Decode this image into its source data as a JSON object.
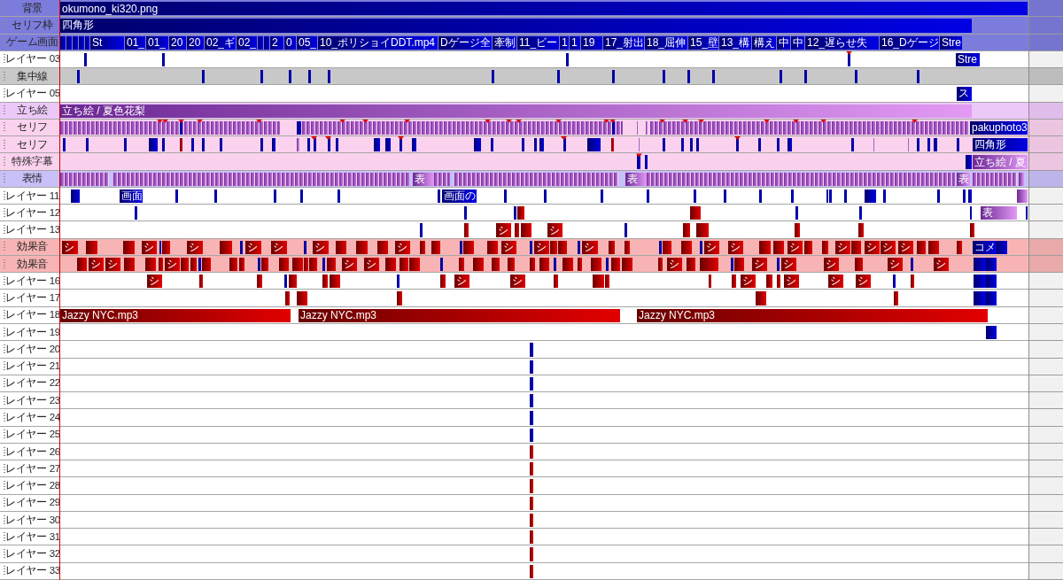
{
  "layers": [
    {
      "label": "背景",
      "color": "#7c7cdc",
      "clips": [
        {
          "kind": "visual",
          "label": "okumono_ki320.png"
        }
      ]
    },
    {
      "label": "セリフ枠",
      "color": "#7c7cdc",
      "clips": [
        {
          "kind": "visual",
          "label": "四角形"
        }
      ]
    },
    {
      "label": "ゲーム画面",
      "color": "#7c7cdc",
      "clips": [
        {
          "kind": "visual"
        },
        {
          "kind": "visual"
        },
        {
          "kind": "visual"
        },
        {
          "kind": "visual"
        },
        {
          "kind": "visual"
        },
        {
          "kind": "visual",
          "label": "St"
        },
        {
          "kind": "visual",
          "label": "01_"
        },
        {
          "kind": "visual",
          "label": "01_"
        },
        {
          "kind": "visual",
          "label": "20"
        },
        {
          "kind": "visual",
          "label": "20"
        },
        {
          "kind": "visual",
          "label": "02_ギ"
        },
        {
          "kind": "visual",
          "label": "02_"
        },
        {
          "kind": "visual"
        },
        {
          "kind": "visual"
        },
        {
          "kind": "visual",
          "label": "2"
        },
        {
          "kind": "visual",
          "label": "0"
        },
        {
          "kind": "visual",
          "label": "05_"
        },
        {
          "kind": "visual",
          "label": "10_ポリショイDDT.mp4"
        },
        {
          "kind": "visual",
          "label": "Dゲージ全"
        },
        {
          "kind": "visual",
          "label": "牽制"
        },
        {
          "kind": "visual",
          "label": "11_ビー"
        },
        {
          "kind": "visual",
          "label": "1"
        },
        {
          "kind": "visual",
          "label": "1"
        },
        {
          "kind": "visual",
          "label": "19"
        },
        {
          "kind": "visual",
          "label": "17_射出"
        },
        {
          "kind": "visual",
          "label": "18_屈伸"
        },
        {
          "kind": "visual",
          "label": "15_壁"
        },
        {
          "kind": "visual",
          "label": "13_構"
        },
        {
          "kind": "visual",
          "label": "構え"
        },
        {
          "kind": "visual",
          "label": "中"
        },
        {
          "kind": "visual",
          "label": "中"
        },
        {
          "kind": "visual",
          "label": "12_遅らせ失"
        },
        {
          "kind": "visual",
          "label": "16_Dゲージ"
        },
        {
          "kind": "visual",
          "label": "Stre"
        }
      ]
    },
    {
      "label": "レイヤー 03",
      "color": "#ffffff",
      "clips": [
        {
          "kind": "visual"
        },
        {
          "kind": "visual"
        },
        {
          "kind": "visual"
        },
        {
          "kind": "visual"
        },
        {
          "kind": "visual",
          "label": "Stre"
        }
      ]
    },
    {
      "label": "集中線",
      "color": "#c8c8c8",
      "clips": [
        {
          "kind": "visual"
        },
        {
          "kind": "visual"
        },
        {
          "kind": "visual"
        },
        {
          "kind": "visual"
        },
        {
          "kind": "visual"
        },
        {
          "kind": "visual"
        },
        {
          "kind": "visual"
        },
        {
          "kind": "visual"
        },
        {
          "kind": "visual"
        },
        {
          "kind": "visual"
        },
        {
          "kind": "visual"
        },
        {
          "kind": "visual"
        },
        {
          "kind": "visual"
        },
        {
          "kind": "visual"
        },
        {
          "kind": "visual"
        },
        {
          "kind": "visual"
        }
      ]
    },
    {
      "label": "レイヤー 05",
      "color": "#ffffff",
      "clips": [
        {
          "kind": "visual",
          "label": "ス"
        }
      ]
    },
    {
      "label": "立ち絵",
      "color": "#ecc8f8",
      "clips": [
        {
          "kind": "character",
          "label": "立ち絵 / 夏色花梨"
        }
      ]
    },
    {
      "label": "セリフ",
      "color": "#fad2ee",
      "clips": [
        {
          "kind": "visual"
        },
        {
          "kind": "visual"
        },
        {
          "kind": "visual"
        },
        {
          "kind": "character"
        },
        {
          "kind": "character"
        },
        {
          "kind": "visual",
          "label": "pakuphoto3"
        }
      ]
    },
    {
      "label": "セリフ",
      "color": "#fad2ee",
      "clips": [
        {
          "kind": "visual"
        },
        {
          "kind": "visual"
        },
        {
          "kind": "visual"
        },
        {
          "kind": "visual"
        },
        {
          "kind": "visual"
        },
        {
          "kind": "audio"
        },
        {
          "kind": "visual"
        },
        {
          "kind": "visual"
        },
        {
          "kind": "visual"
        },
        {
          "kind": "visual"
        },
        {
          "kind": "visual"
        },
        {
          "kind": "character"
        },
        {
          "kind": "visual"
        },
        {
          "kind": "visual"
        },
        {
          "kind": "visual"
        },
        {
          "kind": "visual"
        },
        {
          "kind": "visual"
        },
        {
          "kind": "visual"
        },
        {
          "kind": "visual"
        },
        {
          "kind": "visual"
        },
        {
          "kind": "visual"
        },
        {
          "kind": "visual"
        },
        {
          "kind": "visual"
        },
        {
          "kind": "visual"
        },
        {
          "kind": "visual"
        },
        {
          "kind": "visual"
        },
        {
          "kind": "visual"
        },
        {
          "kind": "audio"
        },
        {
          "kind": "character"
        },
        {
          "kind": "visual"
        },
        {
          "kind": "visual"
        },
        {
          "kind": "visual"
        },
        {
          "kind": "visual"
        },
        {
          "kind": "visual"
        },
        {
          "kind": "visual"
        },
        {
          "kind": "visual"
        },
        {
          "kind": "visual"
        },
        {
          "kind": "visual"
        },
        {
          "kind": "character"
        },
        {
          "kind": "character"
        },
        {
          "kind": "visual"
        },
        {
          "kind": "visual"
        },
        {
          "kind": "visual"
        },
        {
          "kind": "visual"
        },
        {
          "kind": "visual",
          "label": "四角形"
        }
      ]
    },
    {
      "label": "特殊字幕",
      "color": "#fad2ee",
      "clips": [
        {
          "kind": "visual"
        },
        {
          "kind": "visual"
        },
        {
          "kind": "visual"
        },
        {
          "kind": "character",
          "label": "立ち絵 / 夏"
        }
      ]
    },
    {
      "label": "表情",
      "color": "#c8c0f8",
      "clips": [
        {
          "kind": "character",
          "label": "表"
        },
        {
          "kind": "character",
          "label": "表"
        },
        {
          "kind": "character",
          "label": "表"
        },
        {
          "kind": "character"
        }
      ]
    },
    {
      "label": "レイヤー 11",
      "color": "#ffffff",
      "clips": [
        {
          "kind": "visual"
        },
        {
          "kind": "visual",
          "label": "画面"
        },
        {
          "kind": "visual"
        },
        {
          "kind": "visual"
        },
        {
          "kind": "visual"
        },
        {
          "kind": "visual"
        },
        {
          "kind": "visual"
        },
        {
          "kind": "visual"
        },
        {
          "kind": "visual",
          "label": "画面の"
        },
        {
          "kind": "visual"
        },
        {
          "kind": "visual"
        },
        {
          "kind": "visual"
        },
        {
          "kind": "visual"
        },
        {
          "kind": "visual"
        },
        {
          "kind": "visual"
        },
        {
          "kind": "visual"
        },
        {
          "kind": "visual"
        },
        {
          "kind": "visual"
        },
        {
          "kind": "visual"
        },
        {
          "kind": "visual"
        },
        {
          "kind": "visual"
        },
        {
          "kind": "visual"
        },
        {
          "kind": "visual"
        },
        {
          "kind": "visual"
        },
        {
          "kind": "visual"
        },
        {
          "kind": "character"
        }
      ]
    },
    {
      "label": "レイヤー 12",
      "color": "#ffffff",
      "clips": [
        {
          "kind": "visual"
        },
        {
          "kind": "visual"
        },
        {
          "kind": "visual"
        },
        {
          "kind": "audio"
        },
        {
          "kind": "audio"
        },
        {
          "kind": "visual"
        },
        {
          "kind": "visual"
        },
        {
          "kind": "visual"
        },
        {
          "kind": "character",
          "label": "表"
        },
        {
          "kind": "visual"
        }
      ]
    },
    {
      "label": "レイヤー 13",
      "color": "#ffffff",
      "clips": [
        {
          "kind": "visual"
        },
        {
          "kind": "audio"
        },
        {
          "kind": "audio",
          "label": "シ"
        },
        {
          "kind": "audio"
        },
        {
          "kind": "audio"
        },
        {
          "kind": "audio",
          "label": "シ"
        },
        {
          "kind": "visual"
        },
        {
          "kind": "audio"
        },
        {
          "kind": "audio"
        },
        {
          "kind": "audio"
        },
        {
          "kind": "audio"
        },
        {
          "kind": "audio"
        }
      ]
    },
    {
      "label": "効果音",
      "color": "#f8b4b4",
      "clips": [
        {
          "kind": "audio",
          "label": "シ"
        },
        {
          "kind": "audio"
        },
        {
          "kind": "audio"
        },
        {
          "kind": "audio",
          "label": "シ"
        },
        {
          "kind": "visual"
        },
        {
          "kind": "audio"
        },
        {
          "kind": "audio",
          "label": "シ"
        },
        {
          "kind": "audio"
        },
        {
          "kind": "visual"
        },
        {
          "kind": "audio",
          "label": "シ"
        },
        {
          "kind": "audio",
          "label": "シ"
        },
        {
          "kind": "visual"
        },
        {
          "kind": "audio",
          "label": "シ"
        },
        {
          "kind": "audio"
        },
        {
          "kind": "audio"
        },
        {
          "kind": "audio"
        },
        {
          "kind": "audio",
          "label": "シ"
        },
        {
          "kind": "audio"
        },
        {
          "kind": "audio"
        },
        {
          "kind": "visual"
        },
        {
          "kind": "audio"
        },
        {
          "kind": "audio"
        },
        {
          "kind": "audio",
          "label": "シ"
        },
        {
          "kind": "visual"
        },
        {
          "kind": "audio",
          "label": "シ"
        },
        {
          "kind": "audio"
        },
        {
          "kind": "audio"
        },
        {
          "kind": "visual"
        },
        {
          "kind": "audio",
          "label": "シ"
        },
        {
          "kind": "audio"
        },
        {
          "kind": "audio"
        },
        {
          "kind": "visual"
        },
        {
          "kind": "audio"
        },
        {
          "kind": "audio"
        },
        {
          "kind": "visual"
        },
        {
          "kind": "audio",
          "label": "シ"
        },
        {
          "kind": "audio",
          "label": "シ"
        },
        {
          "kind": "audio"
        },
        {
          "kind": "audio"
        },
        {
          "kind": "audio",
          "label": "シ"
        },
        {
          "kind": "audio"
        },
        {
          "kind": "audio"
        },
        {
          "kind": "audio",
          "label": "シ"
        },
        {
          "kind": "audio"
        },
        {
          "kind": "audio",
          "label": "シ"
        },
        {
          "kind": "audio",
          "label": "シ"
        },
        {
          "kind": "audio",
          "label": "シ"
        },
        {
          "kind": "audio"
        },
        {
          "kind": "audio"
        },
        {
          "kind": "audio"
        },
        {
          "kind": "visual",
          "label": "コメ"
        },
        {
          "kind": "visual"
        }
      ]
    },
    {
      "label": "効果音",
      "color": "#f8b4b4",
      "clips": [
        {
          "kind": "audio"
        },
        {
          "kind": "audio",
          "label": "シ"
        },
        {
          "kind": "audio",
          "label": "シ"
        },
        {
          "kind": "audio"
        },
        {
          "kind": "audio"
        },
        {
          "kind": "audio"
        },
        {
          "kind": "audio",
          "label": "シ"
        },
        {
          "kind": "audio"
        },
        {
          "kind": "audio"
        },
        {
          "kind": "visual"
        },
        {
          "kind": "audio"
        },
        {
          "kind": "audio"
        },
        {
          "kind": "audio"
        },
        {
          "kind": "visual"
        },
        {
          "kind": "audio"
        },
        {
          "kind": "audio"
        },
        {
          "kind": "audio"
        },
        {
          "kind": "audio"
        },
        {
          "kind": "audio"
        },
        {
          "kind": "visual"
        },
        {
          "kind": "audio"
        },
        {
          "kind": "audio",
          "label": "シ"
        },
        {
          "kind": "audio",
          "label": "シ"
        },
        {
          "kind": "audio"
        },
        {
          "kind": "audio"
        },
        {
          "kind": "audio"
        },
        {
          "kind": "visual"
        },
        {
          "kind": "audio"
        },
        {
          "kind": "audio"
        },
        {
          "kind": "audio"
        },
        {
          "kind": "audio"
        },
        {
          "kind": "audio"
        },
        {
          "kind": "audio"
        },
        {
          "kind": "visual"
        },
        {
          "kind": "audio"
        },
        {
          "kind": "audio"
        },
        {
          "kind": "audio"
        },
        {
          "kind": "visual"
        },
        {
          "kind": "audio"
        },
        {
          "kind": "audio"
        },
        {
          "kind": "audio"
        },
        {
          "kind": "audio",
          "label": "シ"
        },
        {
          "kind": "audio"
        },
        {
          "kind": "audio"
        },
        {
          "kind": "visual"
        },
        {
          "kind": "audio"
        },
        {
          "kind": "audio",
          "label": "シ"
        },
        {
          "kind": "visual"
        },
        {
          "kind": "audio",
          "label": "シ"
        },
        {
          "kind": "audio",
          "label": "シ"
        },
        {
          "kind": "audio"
        },
        {
          "kind": "audio",
          "label": "シ"
        },
        {
          "kind": "visual"
        },
        {
          "kind": "audio",
          "label": "シ"
        },
        {
          "kind": "visual"
        },
        {
          "kind": "visual"
        }
      ]
    },
    {
      "label": "レイヤー 16",
      "color": "#ffffff",
      "clips": [
        {
          "kind": "audio",
          "label": "シ"
        },
        {
          "kind": "audio"
        },
        {
          "kind": "audio"
        },
        {
          "kind": "visual"
        },
        {
          "kind": "audio"
        },
        {
          "kind": "audio"
        },
        {
          "kind": "audio"
        },
        {
          "kind": "visual"
        },
        {
          "kind": "audio"
        },
        {
          "kind": "audio",
          "label": "シ"
        },
        {
          "kind": "audio",
          "label": "シ"
        },
        {
          "kind": "audio"
        },
        {
          "kind": "audio"
        },
        {
          "kind": "audio"
        },
        {
          "kind": "audio"
        },
        {
          "kind": "audio"
        },
        {
          "kind": "audio",
          "label": "シ"
        },
        {
          "kind": "audio"
        },
        {
          "kind": "audio"
        },
        {
          "kind": "audio",
          "label": "シ"
        },
        {
          "kind": "audio",
          "label": "シ"
        },
        {
          "kind": "audio",
          "label": "シ"
        },
        {
          "kind": "visual"
        },
        {
          "kind": "audio"
        },
        {
          "kind": "visual"
        },
        {
          "kind": "visual"
        }
      ]
    },
    {
      "label": "レイヤー 17",
      "color": "#ffffff",
      "clips": [
        {
          "kind": "audio"
        },
        {
          "kind": "audio"
        },
        {
          "kind": "audio"
        },
        {
          "kind": "audio"
        },
        {
          "kind": "audio"
        },
        {
          "kind": "visual"
        },
        {
          "kind": "visual"
        }
      ]
    },
    {
      "label": "レイヤー 18",
      "color": "#ffffff",
      "clips": [
        {
          "kind": "audio",
          "label": "Jazzy NYC.mp3"
        },
        {
          "kind": "audio",
          "label": "Jazzy NYC.mp3"
        },
        {
          "kind": "audio",
          "label": "Jazzy NYC.mp3"
        }
      ]
    },
    {
      "label": "レイヤー 19",
      "color": "#ffffff",
      "clips": [
        {
          "kind": "visual"
        }
      ]
    },
    {
      "label": "レイヤー 20",
      "color": "#ffffff",
      "clips": [
        {
          "kind": "visual"
        }
      ]
    },
    {
      "label": "レイヤー 21",
      "color": "#ffffff",
      "clips": [
        {
          "kind": "visual"
        }
      ]
    },
    {
      "label": "レイヤー 22",
      "color": "#ffffff",
      "clips": [
        {
          "kind": "visual"
        }
      ]
    },
    {
      "label": "レイヤー 23",
      "color": "#ffffff",
      "clips": [
        {
          "kind": "visual"
        }
      ]
    },
    {
      "label": "レイヤー 24",
      "color": "#ffffff",
      "clips": [
        {
          "kind": "visual"
        }
      ]
    },
    {
      "label": "レイヤー 25",
      "color": "#ffffff",
      "clips": [
        {
          "kind": "visual"
        }
      ]
    },
    {
      "label": "レイヤー 26",
      "color": "#ffffff",
      "clips": [
        {
          "kind": "audio"
        }
      ]
    },
    {
      "label": "レイヤー 27",
      "color": "#ffffff",
      "clips": [
        {
          "kind": "audio"
        }
      ]
    },
    {
      "label": "レイヤー 28",
      "color": "#ffffff",
      "clips": [
        {
          "kind": "audio"
        }
      ]
    },
    {
      "label": "レイヤー 29",
      "color": "#ffffff",
      "clips": [
        {
          "kind": "audio"
        }
      ]
    },
    {
      "label": "レイヤー 30",
      "color": "#ffffff",
      "clips": [
        {
          "kind": "audio"
        }
      ]
    },
    {
      "label": "レイヤー 31",
      "color": "#ffffff",
      "clips": [
        {
          "kind": "audio"
        }
      ]
    },
    {
      "label": "レイヤー 32",
      "color": "#ffffff",
      "clips": [
        {
          "kind": "audio"
        }
      ]
    },
    {
      "label": "レイヤー 33",
      "color": "#ffffff",
      "clips": [
        {
          "kind": "audio"
        }
      ]
    }
  ]
}
